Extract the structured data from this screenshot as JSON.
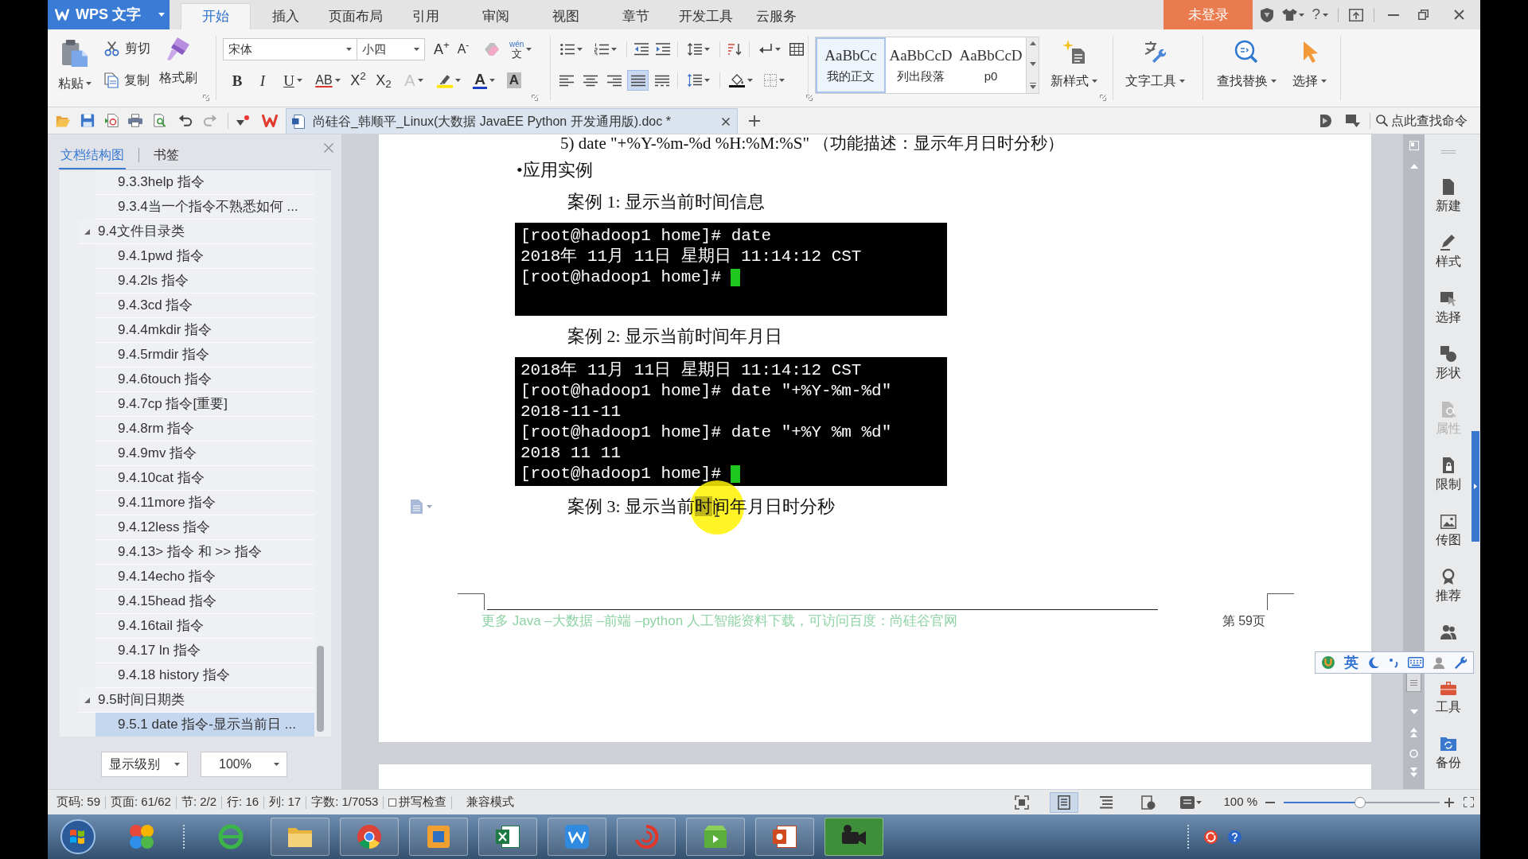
{
  "title_bar": {
    "app_menu": "WPS 文字",
    "tabs": [
      {
        "label": "开始",
        "selected": true
      },
      {
        "label": "插入",
        "selected": false
      },
      {
        "label": "页面布局",
        "selected": false
      },
      {
        "label": "引用",
        "selected": false
      },
      {
        "label": "审阅",
        "selected": false
      },
      {
        "label": "视图",
        "selected": false
      },
      {
        "label": "章节",
        "selected": false
      },
      {
        "label": "开发工具",
        "selected": false
      },
      {
        "label": "云服务",
        "selected": false
      }
    ],
    "login_button": "未登录",
    "help": "?"
  },
  "ribbon": {
    "clipboard": {
      "paste": "粘贴",
      "cut": "剪切",
      "copy": "复制",
      "format_painter": "格式刷"
    },
    "font": {
      "name": "宋体",
      "size": "小四",
      "grow": "A$^{+}$",
      "shrink": "A$^{-}$",
      "phonetic_top": "wén",
      "phonetic_bottom": "文"
    },
    "format_buttons": [
      {
        "kind": "bold",
        "label": "B"
      },
      {
        "kind": "italic",
        "label": "I"
      },
      {
        "kind": "underline",
        "label": "U"
      },
      {
        "kind": "strike",
        "label": "AB"
      },
      {
        "kind": "superscript",
        "label": "X$^{2}$"
      },
      {
        "kind": "subscript",
        "label": "X$_{2}$"
      },
      {
        "kind": "outline",
        "label": "A"
      },
      {
        "kind": "highlight"
      },
      {
        "kind": "color",
        "label": "A"
      },
      {
        "kind": "shading",
        "label": "A"
      }
    ],
    "alignment": [
      {
        "selected": false
      },
      {
        "selected": false
      },
      {
        "selected": false
      },
      {
        "selected": true
      },
      {
        "selected": false
      }
    ],
    "styles": [
      {
        "preview": "AaBbCc",
        "label": "我的正文",
        "selected": true
      },
      {
        "preview": "AaBbCcD",
        "label": "列出段落",
        "selected": false
      },
      {
        "preview": "AaBbCcD",
        "label": "p0",
        "selected": false
      }
    ],
    "tools": [
      {
        "label": "新样式"
      },
      {
        "label": "文字工具"
      },
      {
        "label": "查找替换"
      },
      {
        "label": "选择"
      }
    ]
  },
  "quick_access": {
    "document_tab": {
      "title": "尚硅谷_韩顺平_Linux(大数据 JavaEE Python 开发通用版).doc *",
      "selected": true
    },
    "command_search": {
      "placeholder": "点此查找命令"
    }
  },
  "navigation_pane": {
    "tabs": [
      {
        "label": "文档结构图",
        "selected": true
      },
      {
        "label": "书签",
        "selected": false
      }
    ],
    "tree": [
      {
        "children": [
          {
            "label": "9.3.3help 指令",
            "selected": false
          },
          {
            "label": "9.3.4当一个指令不熟悉如何 ...",
            "selected": false
          }
        ]
      },
      {
        "label": "9.4文件目录类",
        "expanded": true,
        "selected": false,
        "children": [
          {
            "label": "9.4.1pwd 指令",
            "selected": false
          },
          {
            "label": "9.4.2ls 指令",
            "selected": false
          },
          {
            "label": "9.4.3cd 指令",
            "selected": false
          },
          {
            "label": "9.4.4mkdir 指令",
            "selected": false
          },
          {
            "label": "9.4.5rmdir 指令",
            "selected": false
          },
          {
            "label": "9.4.6touch 指令",
            "selected": false
          },
          {
            "label": "9.4.7cp 指令[重要]",
            "selected": false
          },
          {
            "label": "9.4.8rm 指令",
            "selected": false
          },
          {
            "label": "9.4.9mv 指令",
            "selected": false
          },
          {
            "label": "9.4.10cat 指令",
            "selected": false
          },
          {
            "label": "9.4.11more 指令",
            "selected": false
          },
          {
            "label": "9.4.12less 指令",
            "selected": false
          },
          {
            "label": "9.4.13> 指令 和 >> 指令",
            "selected": false
          },
          {
            "label": "9.4.14echo 指令",
            "selected": false
          },
          {
            "label": "9.4.15head 指令",
            "selected": false
          },
          {
            "label": "9.4.16tail 指令",
            "selected": false
          },
          {
            "label": "9.4.17 ln 指令",
            "selected": false
          },
          {
            "label": "9.4.18 history 指令",
            "selected": false
          }
        ]
      },
      {
        "label": "9.5时间日期类",
        "expanded": true,
        "selected": false,
        "children": [
          {
            "label": "9.5.1 date 指令-显示当前日 ...",
            "selected": true
          }
        ]
      }
    ],
    "level_select": "显示级别",
    "zoom_select": "100%"
  },
  "document": {
    "blocks": [
      {
        "kind": "paragraph",
        "text": "5) date \"+%Y-%m-%d %H:%M:%S\" （功能描述：显示年月日时分秒）"
      },
      {
        "kind": "bullet",
        "text": "•应用实例"
      },
      {
        "kind": "caption",
        "parts": [
          {
            "text": "案例 1: 显示当前时间信息",
            "selected": false
          }
        ]
      },
      {
        "kind": "terminal",
        "lines": [
          "[root@hadoop1 home]# date",
          "2018年 11月 11日 星期日 11:14:12 CST",
          "[root@hadoop1 home]#"
        ],
        "cursor": true
      },
      {
        "kind": "caption",
        "parts": [
          {
            "text": "案例 2: 显示当前时间年月日",
            "selected": false
          }
        ]
      },
      {
        "kind": "terminal",
        "lines": [
          "2018年 11月 11日 星期日 11:14:12 CST",
          "[root@hadoop1 home]# date \"+%Y-%m-%d\"",
          "2018-11-11",
          "[root@hadoop1 home]# date \"+%Y %m %d\"",
          "2018 11 11",
          "[root@hadoop1 home]#"
        ],
        "cursor": true
      },
      {
        "kind": "caption",
        "parts": [
          {
            "text": "案例 3: 显示当前",
            "selected": false
          },
          {
            "text": "时",
            "selected": true
          },
          {
            "text": "间年月日时分秒",
            "selected": false
          }
        ]
      }
    ],
    "footer": {
      "text": "更多 Java –大数据 –前端 –python 人工智能资料下载，可访问百度：尚硅谷官网",
      "page_label": "第 59页"
    }
  },
  "side_panel": {
    "items": [
      {
        "label": "新建",
        "disabled": false
      },
      {
        "label": "样式",
        "disabled": false
      },
      {
        "label": "选择",
        "disabled": false
      },
      {
        "label": "形状",
        "disabled": false
      },
      {
        "label": "属性",
        "disabled": true
      },
      {
        "label": "限制",
        "disabled": false
      },
      {
        "label": "传图",
        "disabled": false
      },
      {
        "label": "推荐",
        "disabled": false
      },
      {
        "disabled": false
      },
      {
        "label": "工具",
        "disabled": false
      },
      {
        "label": "备份",
        "disabled": false
      }
    ]
  },
  "ime_bar": {
    "language": "英"
  },
  "status_bar": {
    "fields": [
      "页码: 59",
      "页面: 61/62",
      "节: 2/2",
      "行: 16",
      "列: 17",
      "字数: 1/7053"
    ],
    "spell_check": {
      "label": "拼写检查",
      "checked": false
    },
    "mode": "兼容模式",
    "views": [
      {
        "selected": false
      },
      {
        "selected": true
      },
      {
        "selected": false
      },
      {
        "selected": false
      },
      {
        "selected": false
      }
    ],
    "zoom": {
      "value": "100 %",
      "level": 0.49
    }
  },
  "taskbar": {
    "apps": [
      {
        "running": false,
        "selected": false
      },
      {
        "running": false,
        "selected": false
      },
      {
        "running": true,
        "selected": false
      },
      {
        "running": true,
        "selected": false
      },
      {
        "running": true,
        "selected": false
      },
      {
        "running": true,
        "selected": false
      },
      {
        "running": true,
        "selected": false
      },
      {
        "running": true,
        "selected": false
      },
      {
        "running": true,
        "selected": false
      },
      {
        "running": true,
        "selected": false
      },
      {
        "running": true,
        "selected": true
      }
    ]
  }
}
